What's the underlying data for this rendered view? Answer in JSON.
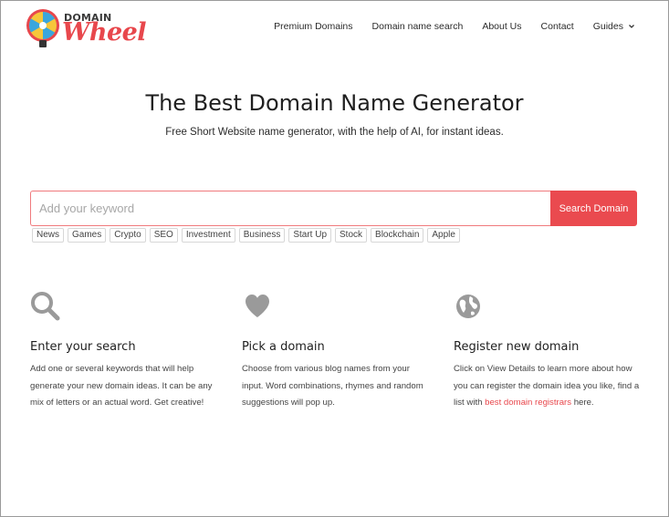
{
  "logo": {
    "domain": "DOMAIN",
    "wheel": "Wheel"
  },
  "nav": {
    "items": [
      "Premium Domains",
      "Domain name search",
      "About Us",
      "Contact",
      "Guides"
    ]
  },
  "hero": {
    "title": "The Best Domain Name Generator",
    "subtitle": "Free Short Website name generator, with the help of AI, for instant ideas."
  },
  "search": {
    "placeholder": "Add your keyword",
    "button_label": "Search Domain",
    "tags": [
      "News",
      "Games",
      "Crypto",
      "SEO",
      "Investment",
      "Business",
      "Start Up",
      "Stock",
      "Blockchain",
      "Apple"
    ]
  },
  "features": [
    {
      "icon": "search-icon",
      "title": "Enter your search",
      "text": "Add one or several keywords that will help generate your new domain ideas. It can be any mix of letters or an actual word. Get creative!"
    },
    {
      "icon": "heart-icon",
      "title": "Pick a domain",
      "text": "Choose from various blog names from your input. Word combinations, rhymes and random suggestions will pop up."
    },
    {
      "icon": "globe-icon",
      "title": "Register new domain",
      "text_before": "Click on View Details to learn more about how you can register the domain idea you like, find a list with ",
      "link": "best domain registrars",
      "text_after": " here."
    }
  ],
  "colors": {
    "accent": "#ea4a4f",
    "icon_gray": "#9a9a9a"
  }
}
